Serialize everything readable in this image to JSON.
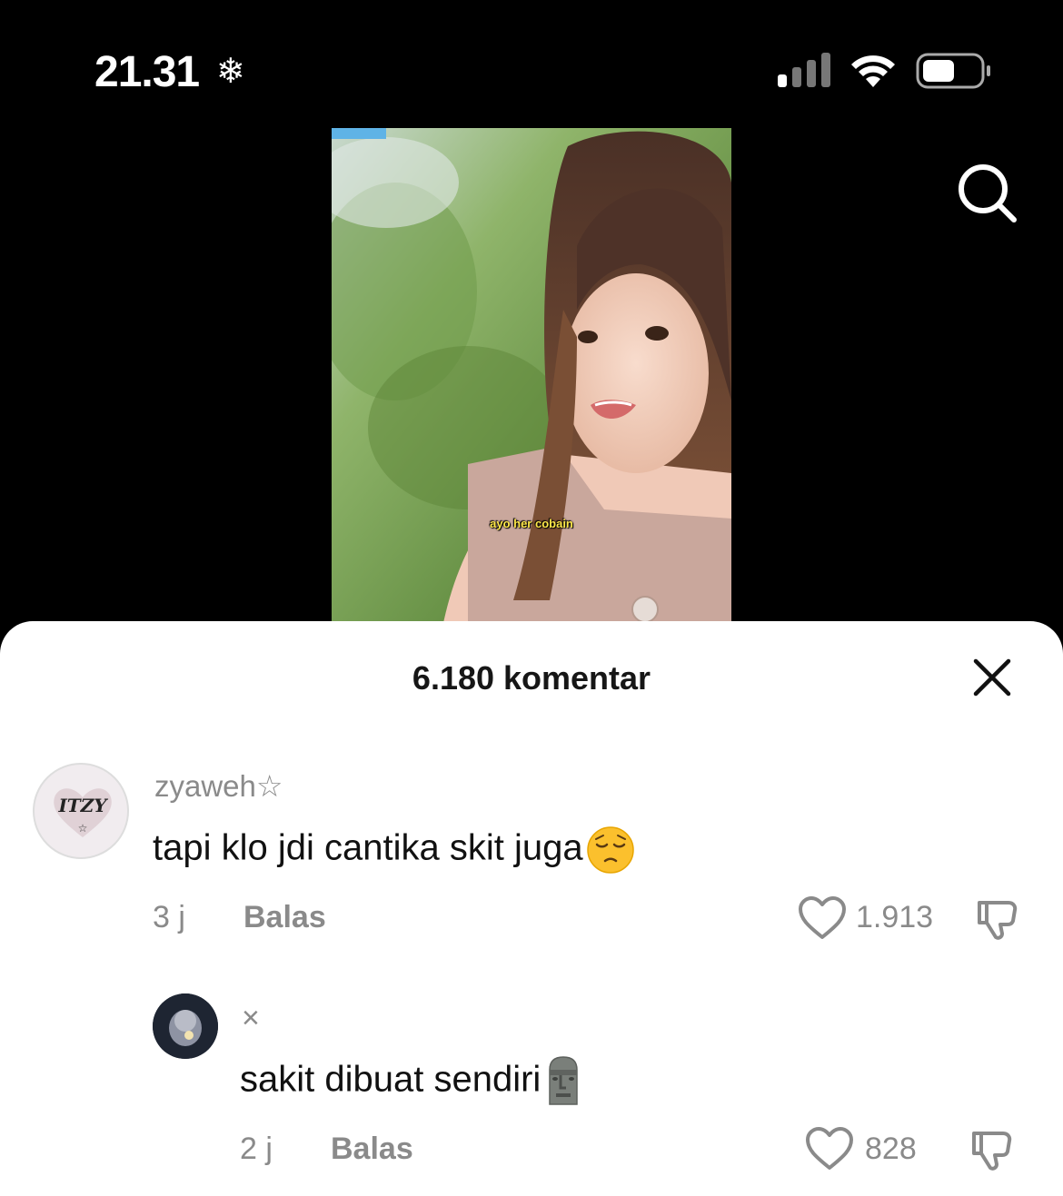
{
  "status_bar": {
    "time": "21.31",
    "extra_icon": "❄",
    "icons": [
      "signal-icon",
      "wifi-icon",
      "battery-icon"
    ]
  },
  "video": {
    "caption": "ayo her cobain"
  },
  "comments_sheet": {
    "title": "6.180 komentar",
    "comments": [
      {
        "avatar_text": "ITZY",
        "username": "zyaweh☆",
        "text": "tapi klo jdi cantika skit juga",
        "emoji": "pensive-face",
        "time": "3 j",
        "reply_label": "Balas",
        "likes": "1.913"
      },
      {
        "username": "×",
        "text": "sakit dibuat sendiri",
        "emoji": "moai",
        "time": "2 j",
        "reply_label": "Balas",
        "likes": "828"
      }
    ]
  },
  "colors": {
    "background": "#000000",
    "sheet": "#ffffff",
    "secondary_text": "#8a8a8a",
    "caption": "#ffe84a"
  }
}
